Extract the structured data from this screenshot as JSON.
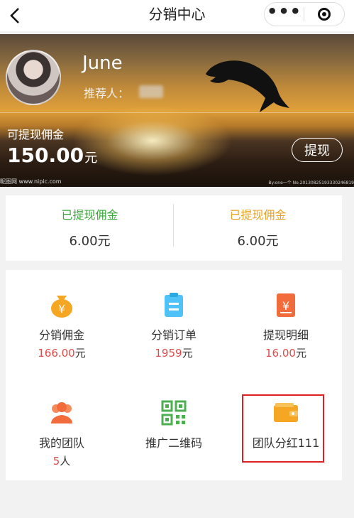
{
  "nav": {
    "title": "分销中心",
    "more_icon": "more-dots-icon",
    "close_icon": "target-close-icon"
  },
  "banner": {
    "username": "June",
    "referrer_label": "推荐人：",
    "available_label": "可提现佣金",
    "available_amount": "150.00",
    "currency_unit": "元",
    "withdraw_button": "提现",
    "watermark_left": "昵图网 www.nipic.com",
    "watermark_right": "By:one一个 No.20130825193330246819"
  },
  "stats": [
    {
      "label": "已提现佣金",
      "value": "6.00元",
      "color": "#39a839"
    },
    {
      "label": "已提现佣金",
      "value": "6.00元",
      "color": "#e8a321"
    }
  ],
  "grid": {
    "items": [
      {
        "label": "分销佣金",
        "value": "166.00",
        "unit": "元",
        "icon": "money-bag-icon"
      },
      {
        "label": "分销订单",
        "value": "1959",
        "unit": "元",
        "icon": "clipboard-icon"
      },
      {
        "label": "提现明细",
        "value": "16.00",
        "unit": "元",
        "icon": "withdraw-detail-icon"
      },
      {
        "label": "我的团队",
        "value": "5",
        "unit": "人",
        "icon": "team-icon"
      },
      {
        "label": "推广二维码",
        "icon": "qr-code-icon"
      },
      {
        "label": "团队分红111",
        "icon": "wallet-icon"
      }
    ]
  },
  "colors": {
    "accent_red": "#e04b4b",
    "green": "#39a839",
    "orange": "#e8a321"
  }
}
